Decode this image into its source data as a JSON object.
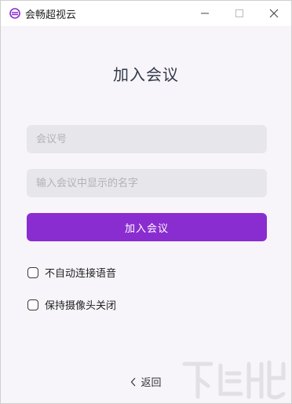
{
  "window": {
    "title": "会畅超视云",
    "controls": {
      "minimize": "minimize-icon",
      "maximize": "maximize-icon",
      "close": "close-icon"
    }
  },
  "main": {
    "heading": "加入会议",
    "meeting_id_placeholder": "会议号",
    "meeting_id_value": "",
    "display_name_placeholder": "输入会议中显示的名字",
    "display_name_value": "",
    "join_button": "加入会议",
    "options": [
      {
        "label": "不自动连接语音",
        "checked": false
      },
      {
        "label": "保持摄像头关闭",
        "checked": false
      }
    ],
    "back_label": "返回"
  },
  "colors": {
    "accent": "#8a2dd0",
    "background": "#f7f5fa",
    "input_bg": "#e7e6ea"
  }
}
